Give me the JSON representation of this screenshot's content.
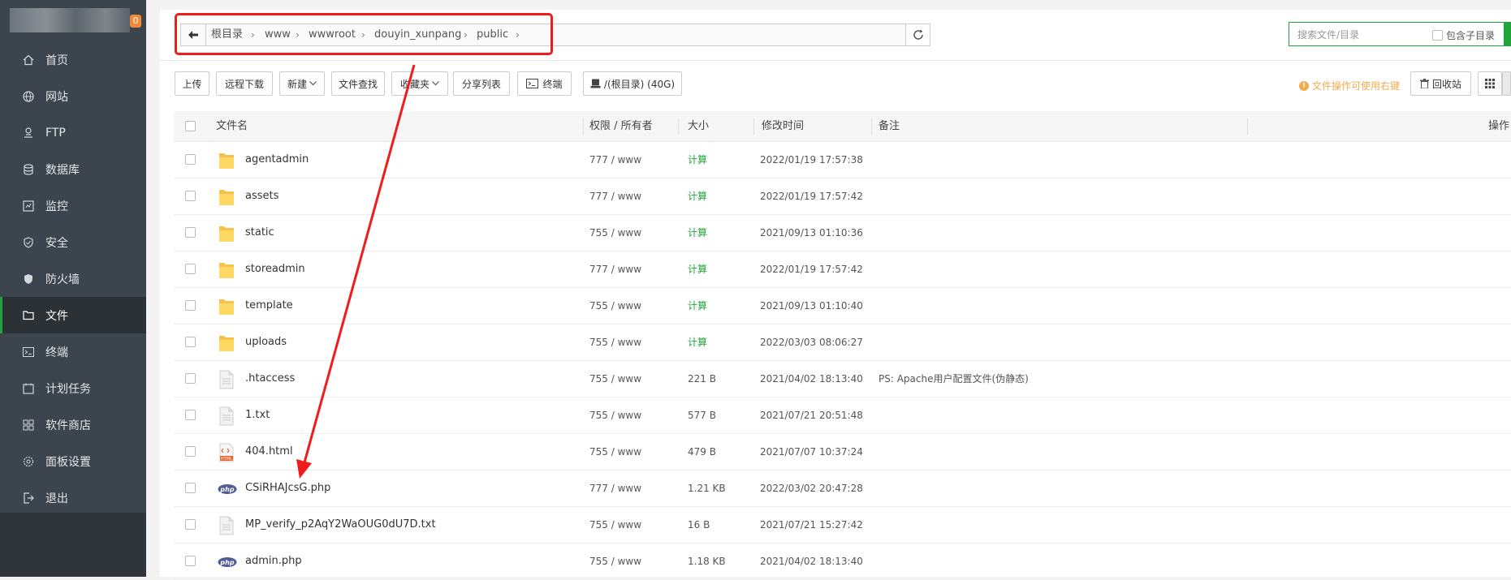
{
  "sidebar": {
    "badge": "0",
    "items": [
      {
        "label": "首页",
        "icon": "home-icon"
      },
      {
        "label": "网站",
        "icon": "globe-icon"
      },
      {
        "label": "FTP",
        "icon": "ftp-icon"
      },
      {
        "label": "数据库",
        "icon": "database-icon"
      },
      {
        "label": "监控",
        "icon": "monitor-icon"
      },
      {
        "label": "安全",
        "icon": "shield-icon"
      },
      {
        "label": "防火墙",
        "icon": "firewall-icon"
      },
      {
        "label": "文件",
        "icon": "folder-icon",
        "active": true
      },
      {
        "label": "终端",
        "icon": "terminal-icon"
      },
      {
        "label": "计划任务",
        "icon": "calendar-icon"
      },
      {
        "label": "软件商店",
        "icon": "apps-icon"
      },
      {
        "label": "面板设置",
        "icon": "settings-icon"
      },
      {
        "label": "退出",
        "icon": "logout-icon"
      }
    ]
  },
  "path": {
    "crumbs": [
      "根目录",
      "www",
      "wwwroot",
      "douyin_xunpang",
      "public"
    ]
  },
  "search": {
    "placeholder": "搜索文件/目录",
    "include_sub_label": "包含子目录"
  },
  "toolbar": {
    "upload": "上传",
    "remote_download": "远程下载",
    "new": "新建",
    "find": "文件查找",
    "favorites": "收藏夹",
    "share_list": "分享列表",
    "terminal": "终端",
    "disk": "/(根目录) (40G)",
    "tip": "文件操作可使用右键",
    "recycle": "回收站"
  },
  "table": {
    "headers": {
      "name": "文件名",
      "perm": "权限 / 所有者",
      "size": "大小",
      "mtime": "修改时间",
      "remark": "备注",
      "ops": "操作"
    },
    "rows": [
      {
        "type": "folder",
        "name": "agentadmin",
        "perm": "777 / www",
        "size": "计算",
        "mtime": "2022/01/19 17:57:38",
        "remark": ""
      },
      {
        "type": "folder",
        "name": "assets",
        "perm": "777 / www",
        "size": "计算",
        "mtime": "2022/01/19 17:57:42",
        "remark": ""
      },
      {
        "type": "folder",
        "name": "static",
        "perm": "755 / www",
        "size": "计算",
        "mtime": "2021/09/13 01:10:36",
        "remark": ""
      },
      {
        "type": "folder",
        "name": "storeadmin",
        "perm": "777 / www",
        "size": "计算",
        "mtime": "2022/01/19 17:57:42",
        "remark": ""
      },
      {
        "type": "folder",
        "name": "template",
        "perm": "755 / www",
        "size": "计算",
        "mtime": "2021/09/13 01:10:40",
        "remark": ""
      },
      {
        "type": "folder",
        "name": "uploads",
        "perm": "755 / www",
        "size": "计算",
        "mtime": "2022/03/03 08:06:27",
        "remark": ""
      },
      {
        "type": "text",
        "name": ".htaccess",
        "perm": "755 / www",
        "size": "221 B",
        "mtime": "2021/04/02 18:13:40",
        "remark": "PS: Apache用户配置文件(伪静态)"
      },
      {
        "type": "text",
        "name": "1.txt",
        "perm": "755 / www",
        "size": "577 B",
        "mtime": "2021/07/21 20:51:48",
        "remark": ""
      },
      {
        "type": "html",
        "name": "404.html",
        "perm": "755 / www",
        "size": "479 B",
        "mtime": "2021/07/07 10:37:24",
        "remark": ""
      },
      {
        "type": "php",
        "name": "CSiRHAJcsG.php",
        "perm": "777 / www",
        "size": "1.21 KB",
        "mtime": "2022/03/02 20:47:28",
        "remark": ""
      },
      {
        "type": "text",
        "name": "MP_verify_p2AqY2WaOUG0dU7D.txt",
        "perm": "755 / www",
        "size": "16 B",
        "mtime": "2021/07/21 15:27:42",
        "remark": ""
      },
      {
        "type": "php",
        "name": "admin.php",
        "perm": "755 / www",
        "size": "1.18 KB",
        "mtime": "2021/04/02 18:13:40",
        "remark": ""
      }
    ]
  },
  "colors": {
    "accent": "#20a53a",
    "annotation": "#f01c1c",
    "sidebar_bg": "#3c444d",
    "warning": "#f0ad4e"
  }
}
